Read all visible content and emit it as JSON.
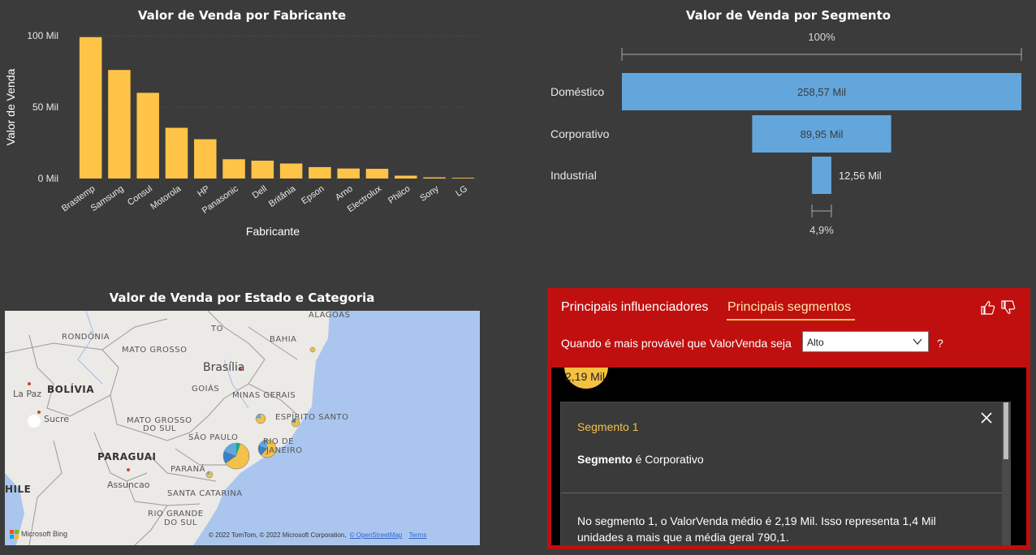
{
  "manufacturer_chart": {
    "title": "Valor de Venda por Fabricante",
    "xlabel": "Fabricante",
    "ylabel": "Valor de Venda",
    "yticks": [
      "100 Mil",
      "50 Mil",
      "0 Mil"
    ],
    "bar_color": "#ffc447"
  },
  "segment_chart": {
    "title": "Valor de Venda por Segmento",
    "top_pct": "100%",
    "bottom_pct": "4,9%",
    "bar_color": "#63a6dc"
  },
  "map_visual": {
    "title": "Valor de Venda por Estado e Categoria",
    "labels": {
      "alagoas": "ALAGOAS",
      "to": "TO",
      "bahia": "BAHIA",
      "rondonia": "RONDÔNIA",
      "mato_grosso": "MATO GROSSO",
      "brasilia": "Brasília",
      "goias": "GOIÁS",
      "minas": "MINAS GERAIS",
      "bolivia": "BOLÍVIA",
      "la_paz": "La Paz",
      "sucre": "Sucre",
      "mgs": "MATO GROSSO",
      "mgs2": "DO SUL",
      "espirito": "ESPÍRITO SANTO",
      "sao_paulo": "SÃO PAULO",
      "rio": "RIO DE",
      "rio2": "JANEIRO",
      "paraguai": "PARAGUAI",
      "parana": "PARANÁ",
      "assuncao": "Assuncao",
      "chile": "HILE",
      "sc": "SANTA CATARINA",
      "rgs": "RIO GRANDE",
      "rgs2": "DO SUL"
    },
    "bing": "Microsoft Bing",
    "attribution": "© 2022 TomTom, © 2022 Microsoft Corporation,",
    "osm": "© OpenStreetMap",
    "terms": "Terms"
  },
  "key_influencers": {
    "tab_influencers": "Principais influenciadores",
    "tab_segments": "Principais segmentos",
    "question": "Quando é mais provável que ValorVenda seja",
    "selected_value": "Alto",
    "help": "?",
    "bubble_label": "2,19 Mil",
    "segment_title": "Segmento 1",
    "segment_field": "Segmento",
    "segment_condition": "é Corporativo",
    "segment_text": "No segmento 1, o ValorVenda médio é 2,19 Mil. Isso representa 1,4 Mil unidades a mais que a média geral 790,1.",
    "thumbs_up_icon": "thumbs-up-icon",
    "thumbs_down_icon": "thumbs-down-icon",
    "close_icon": "close-icon"
  },
  "chart_data": [
    {
      "type": "bar",
      "title": "Valor de Venda por Fabricante",
      "xlabel": "Fabricante",
      "ylabel": "Valor de Venda",
      "categories": [
        "Brastemp",
        "Samsung",
        "Consul",
        "Motorola",
        "HP",
        "Panasonic",
        "Dell",
        "Britânia",
        "Epson",
        "Arno",
        "Electrolux",
        "Philco",
        "Sony",
        "LG"
      ],
      "values": [
        99,
        76,
        60,
        35.5,
        27.5,
        13.5,
        12.5,
        10.5,
        8,
        7,
        6.8,
        2,
        0.8,
        0.5
      ],
      "ylim": [
        0,
        100
      ],
      "unit": "Mil",
      "grid": true
    },
    {
      "type": "bar",
      "title": "Valor de Venda por Segmento",
      "categories": [
        "Doméstico",
        "Corporativo",
        "Industrial"
      ],
      "values": [
        258.57,
        89.95,
        12.56
      ],
      "labels": [
        "258,57 Mil",
        "89,95 Mil",
        "12,56 Mil"
      ],
      "unit": "Mil",
      "top_pct": "100%",
      "bottom_pct": "4,9%"
    }
  ]
}
